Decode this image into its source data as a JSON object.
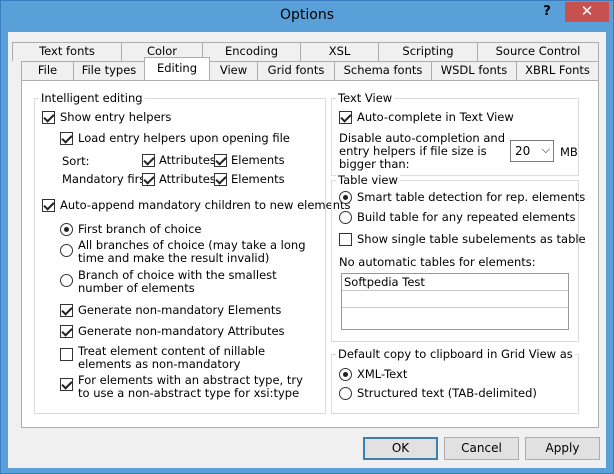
{
  "window": {
    "title": "Options",
    "help_glyph": "?",
    "close_glyph": "✕"
  },
  "tabs_row1": [
    "Text fonts",
    "Color",
    "Encoding",
    "XSL",
    "Scripting",
    "Source Control"
  ],
  "tabs_row2": [
    "File",
    "File types",
    "Editing",
    "View",
    "Grid fonts",
    "Schema fonts",
    "WSDL fonts",
    "XBRL Fonts"
  ],
  "active_tab": "Editing",
  "intelligent_editing": {
    "legend": "Intelligent editing",
    "show_entry_helpers": {
      "label": "Show entry helpers",
      "checked": true
    },
    "load_entry_helpers": {
      "label": "Load entry helpers upon opening file",
      "checked": true
    },
    "sort_label": "Sort:",
    "sort_attributes": {
      "label": "Attributes",
      "checked": true
    },
    "sort_elements": {
      "label": "Elements",
      "checked": true
    },
    "mandatory_label": "Mandatory first:",
    "mandatory_attributes": {
      "label": "Attributes",
      "checked": true
    },
    "mandatory_elements": {
      "label": "Elements",
      "checked": true
    },
    "auto_append": {
      "label": "Auto-append mandatory children to new elements",
      "checked": true
    },
    "first_branch": {
      "label": "First branch of choice",
      "checked": true
    },
    "all_branches": {
      "label": "All branches of choice (may take a long time and make the result invalid)",
      "checked": false
    },
    "smallest_branch": {
      "label": "Branch of choice with the smallest number of elements",
      "checked": false
    },
    "gen_elements": {
      "label": "Generate non-mandatory Elements",
      "checked": true
    },
    "gen_attributes": {
      "label": "Generate non-mandatory Attributes",
      "checked": true
    },
    "nillable": {
      "label": "Treat element content of nillable elements as non-mandatory",
      "checked": false
    },
    "abstract_type": {
      "label": "For elements with an abstract type, try to use a non-abstract type  for xsi:type",
      "checked": true
    }
  },
  "text_view": {
    "legend": "Text View",
    "auto_complete": {
      "label": "Auto-complete in Text View",
      "checked": true
    },
    "disable_text": "Disable auto-completion and entry helpers if file size is bigger than:",
    "size_value": "20",
    "size_unit": "MB"
  },
  "table_view": {
    "legend": "Table view",
    "smart_detection": {
      "label": "Smart table detection for rep. elements",
      "checked": true
    },
    "build_any": {
      "label": "Build table for any repeated elements",
      "checked": false
    },
    "show_single": {
      "label": "Show single table subelements as table",
      "checked": false
    },
    "no_auto_label": "No automatic tables for elements:",
    "no_auto_items": [
      "Softpedia Test",
      "",
      "",
      ""
    ]
  },
  "clipboard": {
    "legend": "Default copy to clipboard in Grid View as",
    "xml_text": {
      "label": "XML-Text",
      "checked": true
    },
    "structured": {
      "label": "Structured text (TAB-delimited)",
      "checked": false
    }
  },
  "buttons": {
    "ok": "OK",
    "cancel": "Cancel",
    "apply": "Apply"
  }
}
